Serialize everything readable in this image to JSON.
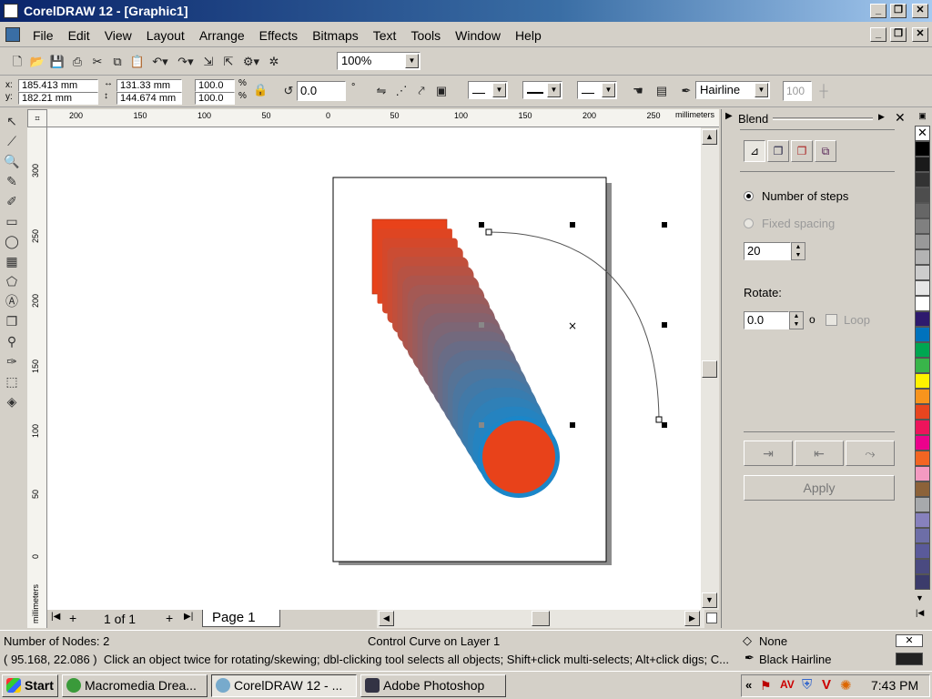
{
  "window": {
    "title": "CorelDRAW 12 - [Graphic1]"
  },
  "menu": [
    "File",
    "Edit",
    "View",
    "Layout",
    "Arrange",
    "Effects",
    "Bitmaps",
    "Text",
    "Tools",
    "Window",
    "Help"
  ],
  "standard_toolbar": {
    "zoom": "100%"
  },
  "property_bar": {
    "x": "185.413 mm",
    "y": "182.21 mm",
    "width": "131.33 mm",
    "height": "144.674 mm",
    "scale_x": "100.0",
    "scale_y": "100.0",
    "percent": "%",
    "angle": "0.0",
    "degree": "°",
    "outline_width": "Hairline",
    "rotate_small": "100"
  },
  "rulers": {
    "unit": "millimeters",
    "h_ticks": [
      "200",
      "150",
      "100",
      "50",
      "0",
      "50",
      "100",
      "150",
      "200",
      "250"
    ],
    "v_ticks": [
      "300",
      "250",
      "200",
      "150",
      "100",
      "50",
      "0"
    ]
  },
  "page_nav": {
    "counter": "1 of 1",
    "tab": "Page 1"
  },
  "blend_docker": {
    "title": "Blend",
    "number_of_steps_label": "Number of steps",
    "fixed_spacing_label": "Fixed spacing",
    "steps": "20",
    "rotate_label": "Rotate:",
    "rotate_value": "0.0",
    "rotate_unit": "o",
    "loop_label": "Loop",
    "apply_label": "Apply"
  },
  "palette_colors": [
    "#ffffff",
    "#000000",
    "#1a1a1a",
    "#333333",
    "#4d4d4d",
    "#666666",
    "#808080",
    "#999999",
    "#b3b3b3",
    "#cccccc",
    "#e6e6e6",
    "#ffffff",
    "#2e1a6e",
    "#0072bc",
    "#00a651",
    "#39b54a",
    "#fff200",
    "#f7941d",
    "#e8451f",
    "#ed145b",
    "#ec008c",
    "#f26522",
    "#f49ac1",
    "#8c6239",
    "#a7a9ac",
    "#8781bd",
    "#6d6ea7",
    "#5a5a9a",
    "#4a4a80",
    "#3b3b6b"
  ],
  "status": {
    "nodes": "Number of Nodes: 2",
    "layer": "Control Curve on Layer 1",
    "fill": "None",
    "coords": "( 95.168, 22.086 )",
    "hint": "Click an object twice for rotating/skewing; dbl-clicking tool selects all objects; Shift+click multi-selects; Alt+click digs; C...",
    "outline": "Black  Hairline"
  },
  "taskbar": {
    "start": "Start",
    "tasks": [
      "Macromedia Drea...",
      "CorelDRAW 12 - ...",
      "Adobe Photoshop"
    ],
    "clock": "7:43 PM"
  },
  "colors": {
    "orange": "#e8421a",
    "blue": "#1b86c8"
  }
}
